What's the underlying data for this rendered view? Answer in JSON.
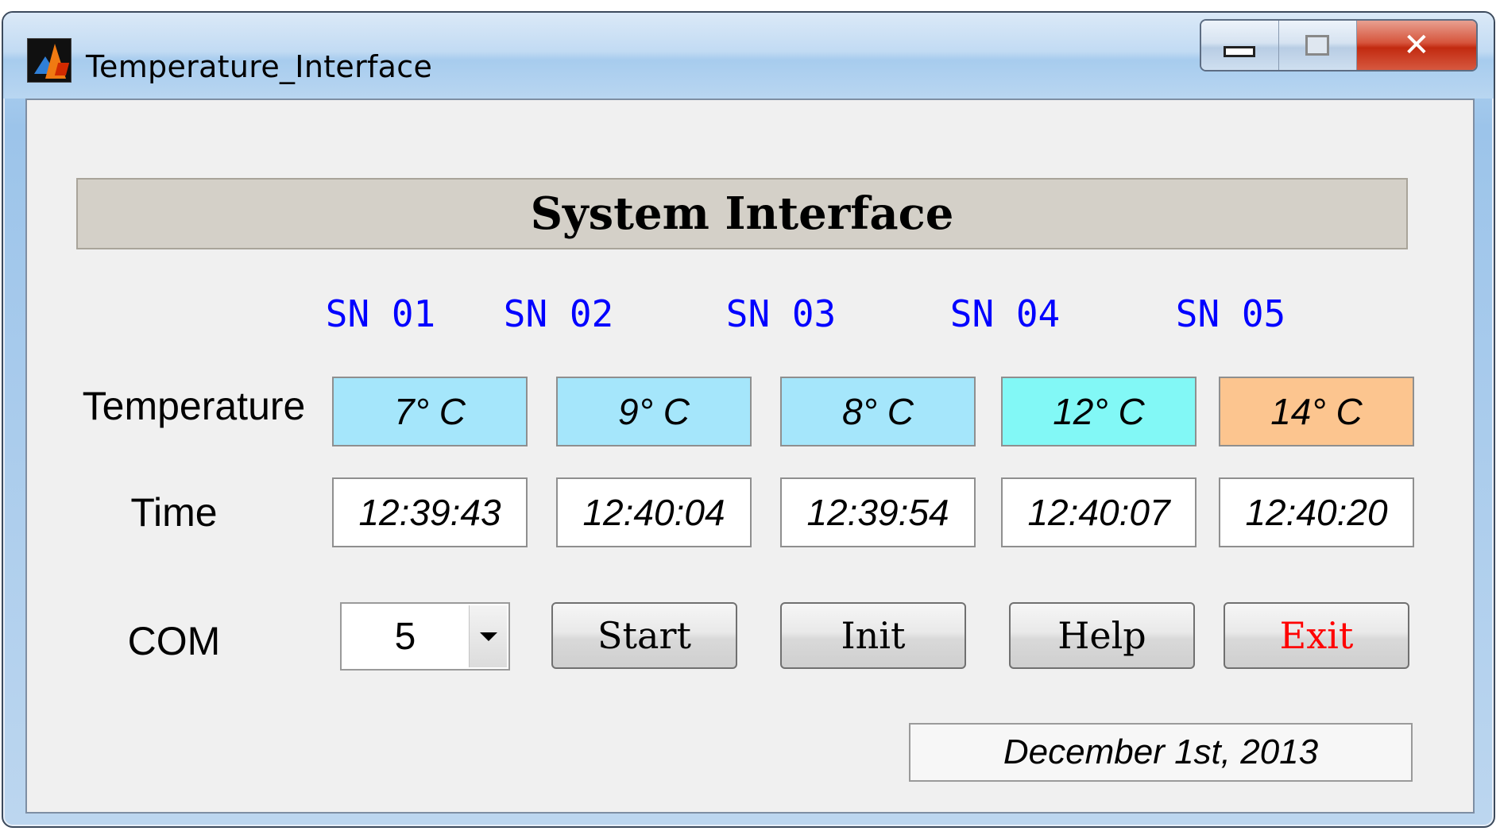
{
  "window": {
    "title": "Temperature_Interface",
    "minimize_label": "",
    "maximize_label": "",
    "close_label": "✕"
  },
  "header": {
    "title": "System Interface"
  },
  "sensors": [
    {
      "label": "SN 01",
      "temperature": "7° C",
      "time": "12:39:43",
      "color": "#a5e6fb"
    },
    {
      "label": "SN 02",
      "temperature": "9° C",
      "time": "12:40:04",
      "color": "#a5e6fb"
    },
    {
      "label": "SN 03",
      "temperature": "8° C",
      "time": "12:39:54",
      "color": "#a5e6fb"
    },
    {
      "label": "SN 04",
      "temperature": "12° C",
      "time": "12:40:07",
      "color": "#82f8f6"
    },
    {
      "label": "SN 05",
      "temperature": "14° C",
      "time": "12:40:20",
      "color": "#fcc58f"
    }
  ],
  "rows": {
    "temperature_label": "Temperature",
    "time_label": "Time",
    "com_label": "COM"
  },
  "com": {
    "selected": "5"
  },
  "buttons": {
    "start": "Start",
    "init": "Init",
    "help": "Help",
    "exit": "Exit",
    "exit_color": "#ff0000"
  },
  "date": "December 1st, 2013",
  "colors": {
    "sensor_label": "#0000ff",
    "banner_bg": "#d4d0c8",
    "panel_bg": "#f0f0f0"
  }
}
